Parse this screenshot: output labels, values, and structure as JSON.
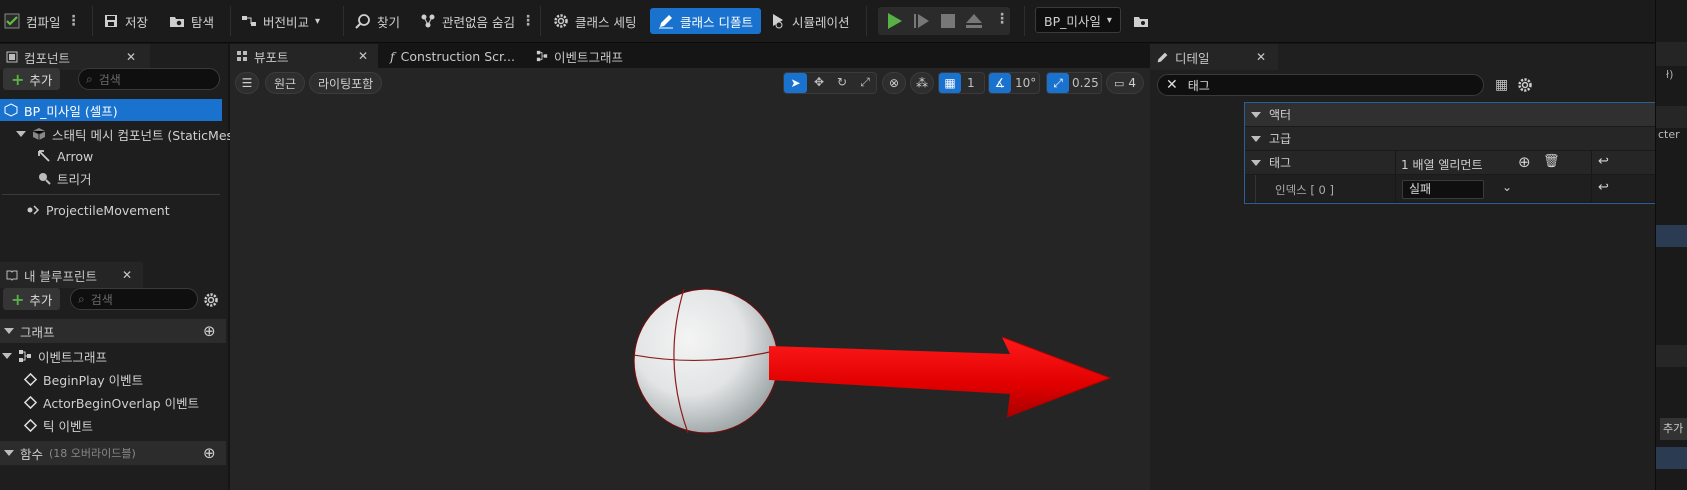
{
  "toolbar": {
    "compile": "컴파일",
    "save": "저장",
    "browse": "탐색",
    "diff": "버전비교",
    "find": "찾기",
    "hide_unrelated": "관련없음 숨김",
    "class_settings": "클래스 세팅",
    "class_defaults": "클래스 디폴트",
    "simulation": "시뮬레이션",
    "debug_object": "BP_미사일"
  },
  "components_panel": {
    "tab_label": "컴포넌트",
    "add_label": "추가",
    "search_placeholder": "검색",
    "items": [
      {
        "label": "BP_미사일 (셀프)"
      },
      {
        "label": "스태틱 메시 컴포넌트 (StaticMesh"
      },
      {
        "label": "Arrow"
      },
      {
        "label": "트리거"
      },
      {
        "label": "ProjectileMovement"
      }
    ]
  },
  "blueprint_panel": {
    "tab_label": "내 블루프린트",
    "add_label": "추가",
    "search_placeholder": "검색",
    "graph_section": "그래프",
    "event_graph": "이벤트그래프",
    "events": [
      "BeginPlay 이벤트",
      "ActorBeginOverlap 이벤트",
      "틱 이벤트"
    ],
    "functions_section": "함수",
    "functions_sub": "(18 오버라이드블)"
  },
  "editor_tabs": {
    "viewport": "뷰포트",
    "construction": "Construction Scr...",
    "event_graph": "이벤트그래프"
  },
  "viewport": {
    "perspective": "원근",
    "lighting": "라이팅포함",
    "grid_snap": "1",
    "rotation_snap": "10°",
    "scale_snap": "0.25",
    "camera_speed": "4"
  },
  "details_panel": {
    "tab_label": "디테일",
    "search_value": "태그",
    "actor_section": "액터",
    "advanced_section": "고급",
    "tags_label": "태그",
    "array_elements": "1 배열 엘리먼트",
    "index_label": "인덱스 [ 0 ]",
    "index_value": "실패"
  },
  "right_edge": {
    "text1": "ł)",
    "text2": "cter",
    "add_btn": "추가"
  },
  "colors": {
    "accent": "#1a72cf",
    "selected_row": "#1a72cf",
    "play_green": "#58b144",
    "arrow_red": "#e00000"
  }
}
